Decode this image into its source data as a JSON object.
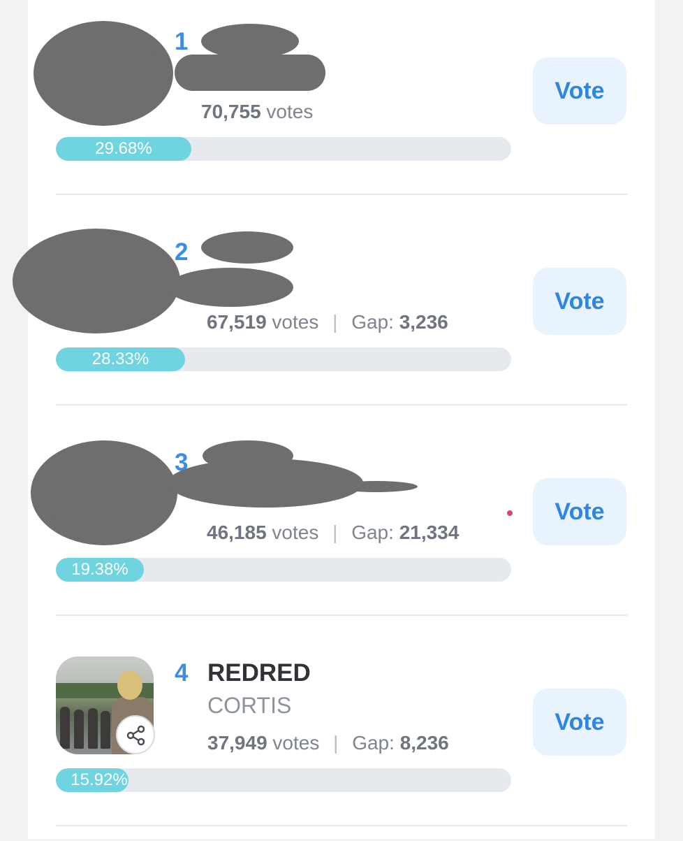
{
  "entries": [
    {
      "rank": "1",
      "song": "",
      "artist": "",
      "votes_count": "70,755",
      "votes_label": "votes",
      "gap_label": "",
      "gap_value": "",
      "percent_text": "29.68%",
      "percent": 29.68,
      "vote_label": "Vote",
      "redacted": true
    },
    {
      "rank": "2",
      "song": "",
      "artist": "",
      "votes_count": "67,519",
      "votes_label": "votes",
      "gap_label": "Gap:",
      "gap_value": "3,236",
      "percent_text": "28.33%",
      "percent": 28.33,
      "vote_label": "Vote",
      "redacted": true
    },
    {
      "rank": "3",
      "song": "",
      "artist": "",
      "votes_count": "46,185",
      "votes_label": "votes",
      "gap_label": "Gap:",
      "gap_value": "21,334",
      "percent_text": "19.38%",
      "percent": 19.38,
      "vote_label": "Vote",
      "redacted": true
    },
    {
      "rank": "4",
      "song": "REDRED",
      "artist": "CORTIS",
      "votes_count": "37,949",
      "votes_label": "votes",
      "gap_label": "Gap:",
      "gap_value": "8,236",
      "percent_text": "15.92%",
      "percent": 15.92,
      "vote_label": "Vote",
      "redacted": false
    }
  ],
  "colors": {
    "rank": "#3d8ce6",
    "bar_fill": "#6fd3e0",
    "bar_track": "#e6e9ee",
    "vote_button_bg": "#e8f3fd",
    "vote_button_text": "#2f86de"
  },
  "icons": {
    "share": "share-icon"
  }
}
